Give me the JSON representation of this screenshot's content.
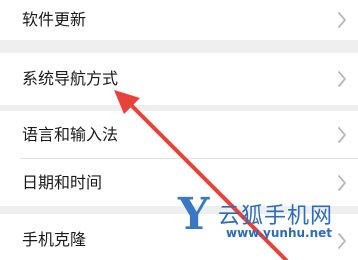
{
  "settings_list": {
    "items": [
      {
        "label": "软件更新"
      },
      {
        "label": "系统导航方式"
      },
      {
        "label": "语言和输入法"
      },
      {
        "label": "日期和时间"
      },
      {
        "label": "手机克隆"
      }
    ]
  },
  "watermark": {
    "logo_letter": "Y",
    "brand_text": "云狐手机网",
    "url_text": "www.yunhu.net"
  },
  "colors": {
    "annotation_arrow": "#e8433b",
    "watermark_blue": "#2f6cb8",
    "background": "#efefef"
  }
}
